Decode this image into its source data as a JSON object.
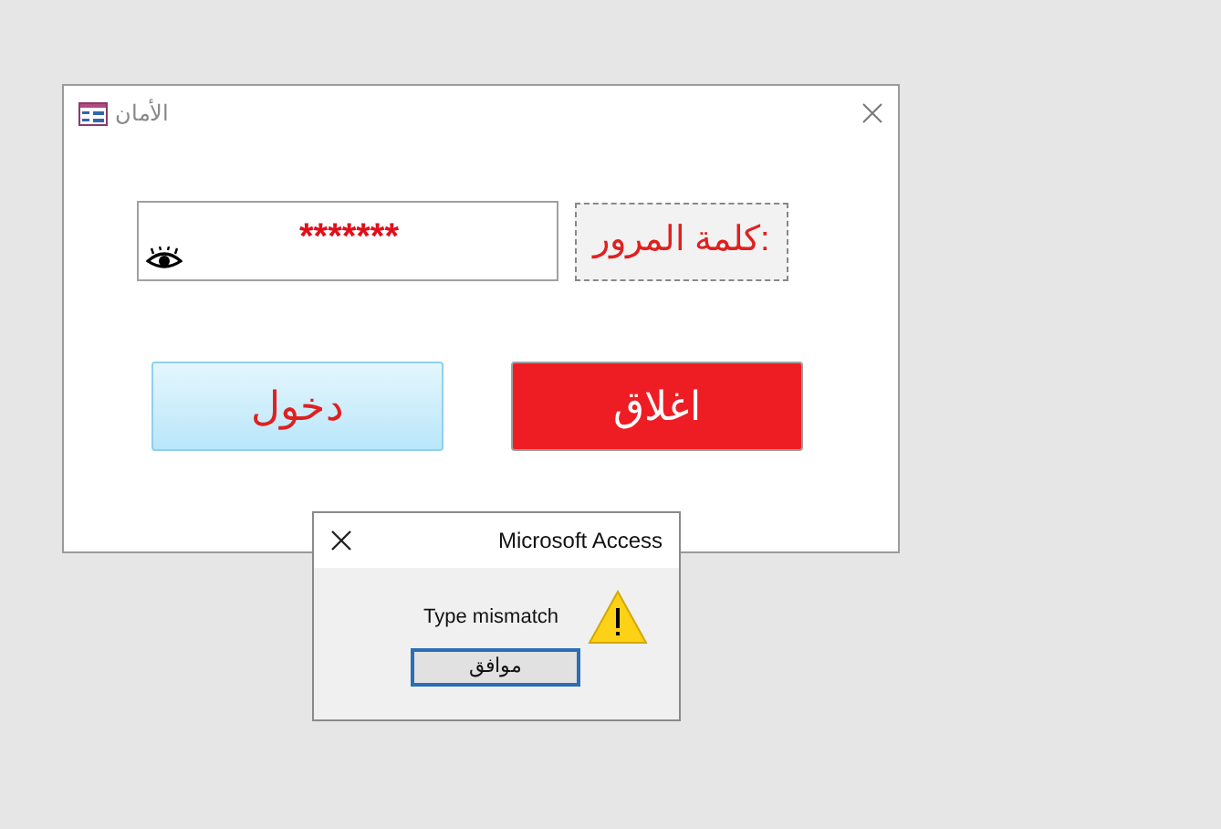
{
  "form_window": {
    "title": "الأمان",
    "password_field": {
      "value": "*******"
    },
    "password_label": "كلمة المرور:",
    "buttons": [
      {
        "kind": "close",
        "label": "اغلاق"
      },
      {
        "kind": "login",
        "label": "دخول"
      }
    ]
  },
  "message_box": {
    "title": "Microsoft Access",
    "message": "Type mismatch",
    "button": "موافق"
  }
}
